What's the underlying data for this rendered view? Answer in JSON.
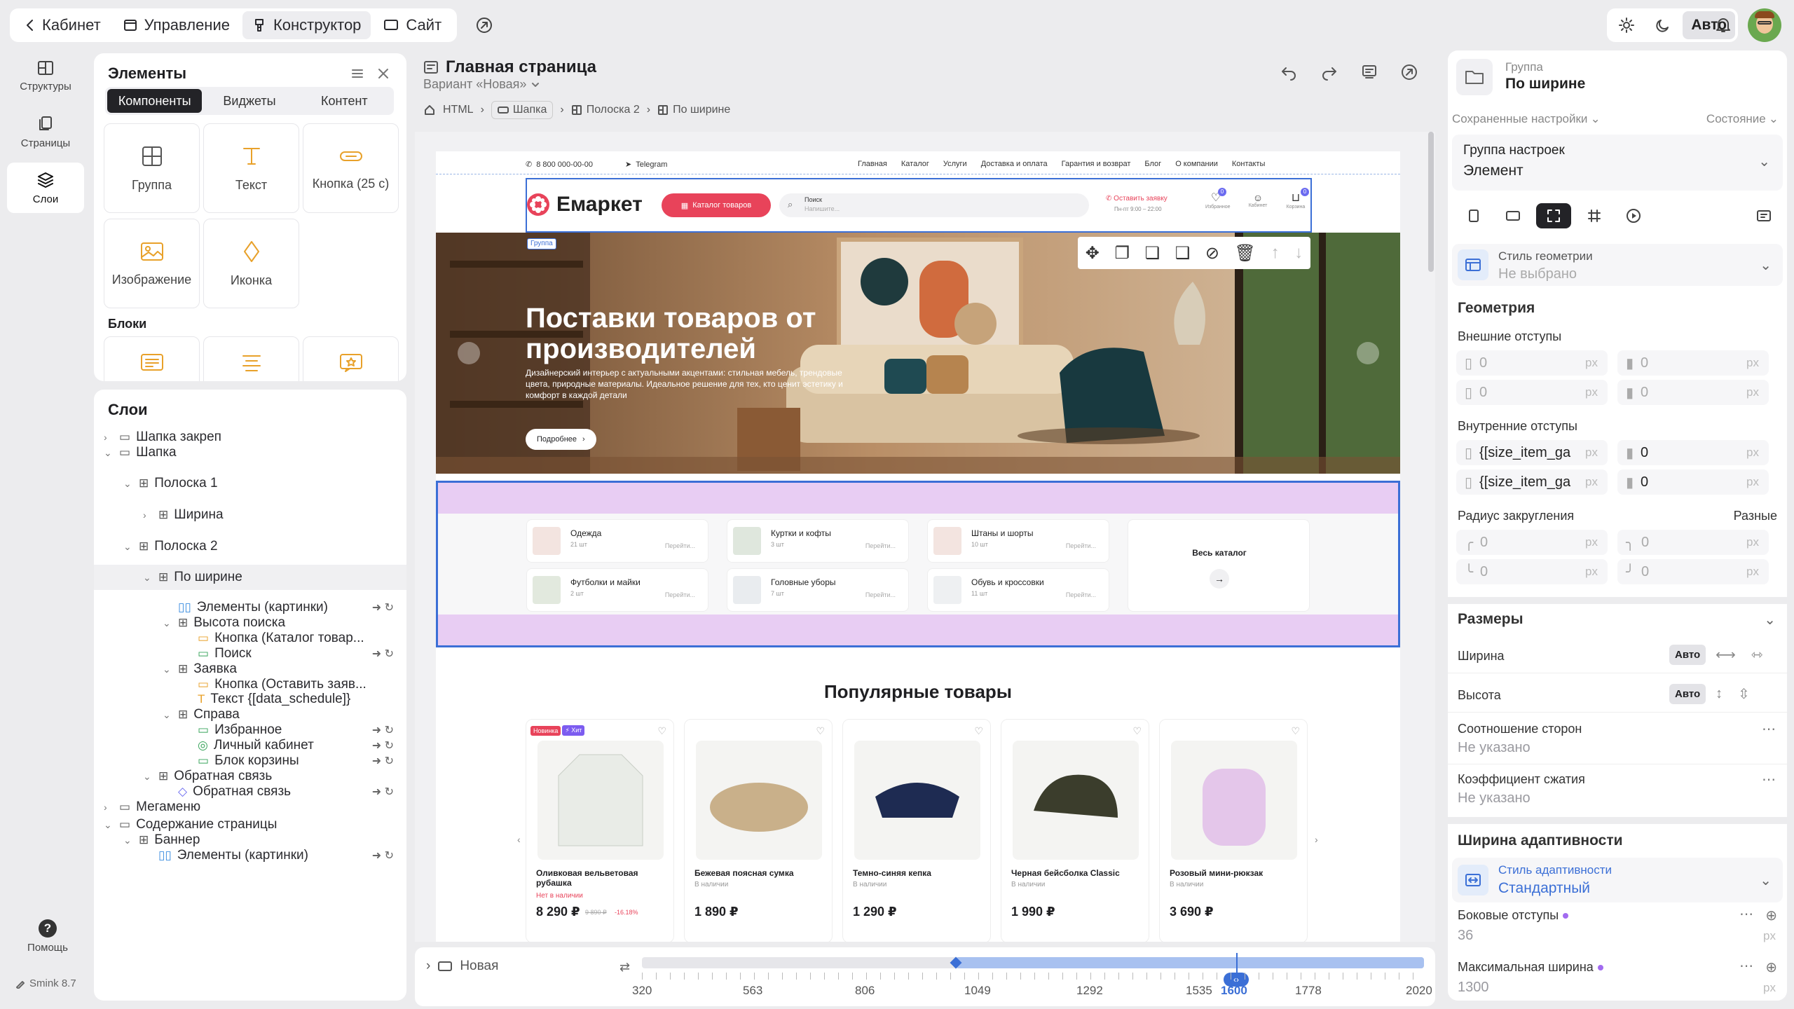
{
  "topnav": {
    "back": "Кабинет",
    "manage": "Управление",
    "builder": "Конструктор",
    "site": "Сайт"
  },
  "theme": {
    "auto": "Авто"
  },
  "rail": {
    "structures": "Структуры",
    "pages": "Страницы",
    "layers": "Слои",
    "help": "Помощь",
    "version": "Smink 8.7"
  },
  "elements": {
    "title": "Элементы",
    "tabs": [
      "Компоненты",
      "Виджеты",
      "Контент"
    ],
    "tiles": [
      "Группа",
      "Текст",
      "Кнопка (25 с)",
      "Изображение",
      "Иконка"
    ],
    "blocks_title": "Блоки"
  },
  "layers": {
    "title": "Слои",
    "items": [
      "Шапка закреп",
      "Шапка",
      "Полоска 1",
      "Ширина",
      "Полоска 2",
      "По ширине",
      "Элементы (картинки)",
      "Высота поиска",
      "Кнопка (Каталог товар...",
      "Поиск",
      "Заявка",
      "Кнопка (Оставить заяв...",
      "Текст {[data_schedule]}",
      "Справа",
      "Избранное",
      "Личный кабинет",
      "Блок корзины",
      "Обратная связь",
      "Обратная связь",
      "Мегаменю",
      "Содержание страницы",
      "Баннер",
      "Элементы (картинки)"
    ]
  },
  "page": {
    "title": "Главная страница",
    "variant": "Вариант «Новая»",
    "crumbs": [
      "HTML",
      "Шапка",
      "Полоска 2",
      "По ширине"
    ]
  },
  "site": {
    "phone": "8 800 000-00-00",
    "telegram": "Telegram",
    "menu": [
      "Главная",
      "Каталог",
      "Услуги",
      "Доставка и оплата",
      "Гарантия и возврат",
      "Блог",
      "О компании",
      "Контакты"
    ],
    "logo": "Емаркет",
    "catalog_btn": "Каталог товаров",
    "search_label": "Поиск",
    "search_placeholder": "Напишите...",
    "callback": "Оставить заявку",
    "schedule": "Пн-пт 9:00 – 22:00",
    "icons": [
      "Избранное",
      "Кабинет",
      "Корзина"
    ],
    "badge_fav": "0",
    "badge_cart": "0",
    "group_tag": "Группа",
    "hero_title": "Поставки товаров от производителей",
    "hero_text": "Дизайнерский интерьер с актуальными акцентами: стильная мебель, трендовые цвета, природные материалы. Идеальное решение для тех, кто ценит эстетику и комфорт в каждой детали",
    "hero_btn": "Подробнее",
    "categories": [
      {
        "name": "Одежда",
        "count": "21 шт",
        "go": "Перейти..."
      },
      {
        "name": "Куртки и кофты",
        "count": "3 шт",
        "go": "Перейти..."
      },
      {
        "name": "Штаны и шорты",
        "count": "10 шт",
        "go": "Перейти..."
      },
      {
        "name": "Футболки и майки",
        "count": "2 шт",
        "go": "Перейти..."
      },
      {
        "name": "Головные уборы",
        "count": "7 шт",
        "go": "Перейти..."
      },
      {
        "name": "Обувь и кроссовки",
        "count": "11 шт",
        "go": "Перейти..."
      }
    ],
    "all_catalog": "Весь каталог",
    "popular": "Популярные товары",
    "products": [
      {
        "name": "Оливковая вельветовая рубашка",
        "stock": "Нет в наличии",
        "price": "8 290 ₽",
        "old": "9 890 ₽",
        "disc": "-16.18%",
        "tags": [
          "Новинка",
          "⚡ Хит"
        ]
      },
      {
        "name": "Бежевая поясная сумка",
        "stock": "В наличии",
        "price": "1 890 ₽"
      },
      {
        "name": "Темно-синяя кепка",
        "stock": "В наличии",
        "price": "1 290 ₽"
      },
      {
        "name": "Черная бейсболка Classic",
        "stock": "В наличии",
        "price": "1 990 ₽"
      },
      {
        "name": "Розовый мини-рюкзак",
        "stock": "В наличии",
        "price": "3 690 ₽"
      }
    ]
  },
  "bottom": {
    "variant": "Новая",
    "ticks": [
      "320",
      "563",
      "806",
      "1049",
      "1292",
      "1535",
      "1600",
      "1778",
      "2020"
    ],
    "current": "1600"
  },
  "right": {
    "group_label": "Группа",
    "group_value": "По ширине",
    "saved": "Сохраненные настройки",
    "state": "Состояние",
    "preset_title": "Группа настроек",
    "preset_value": "Элемент",
    "geom_style": "Стиль геометрии",
    "geom_style_value": "Не выбрано",
    "geometry": "Геометрия",
    "outer": "Внешние отступы",
    "inner": "Внутренние отступы",
    "radius": "Радиус закругления",
    "radius_mode": "Разные",
    "zero": "0",
    "size_var": "{[size_item_ga",
    "unit": "px",
    "sizes": "Размеры",
    "width": "Ширина",
    "height": "Высота",
    "auto": "Авто",
    "aspect": "Соотношение сторон",
    "aspect_value": "Не указано",
    "shrink": "Коэффициент сжатия",
    "shrink_value": "Не указано",
    "adapt": "Ширина адаптивности",
    "adapt_style": "Стиль адаптивности",
    "adapt_value": "Стандартный",
    "side": "Боковые отступы",
    "side_value": "36",
    "maxw": "Максимальная ширина",
    "maxw_value": "1300"
  },
  "colors": {
    "accent": "#e8435a",
    "select": "#3b6fd6",
    "purple": "#e8cdf3"
  }
}
